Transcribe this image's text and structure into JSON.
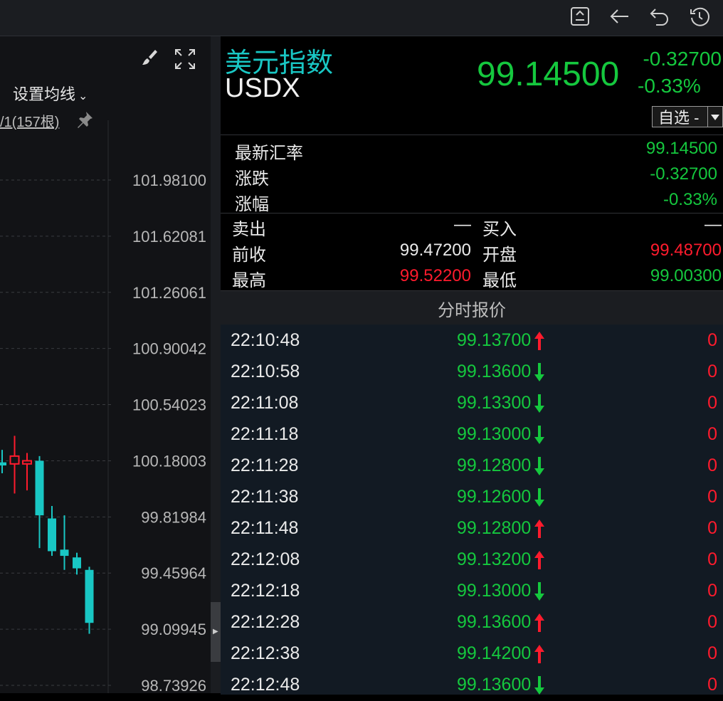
{
  "toolbar": {
    "icons": [
      "export-icon",
      "back-arrow-icon",
      "undo-icon",
      "history-icon"
    ]
  },
  "chart": {
    "ma_setting_label": "设置均线",
    "bars_info": "/1(157根)",
    "price_labels": [
      "101.98100",
      "101.62081",
      "101.26061",
      "100.90042",
      "100.54023",
      "100.18003",
      "99.81984",
      "99.45964",
      "99.09945",
      "98.73926"
    ]
  },
  "chart_data": {
    "type": "candlestick",
    "y_ticks": [
      101.981,
      101.62081,
      101.26061,
      100.90042,
      100.54023,
      100.18003,
      99.81984,
      99.45964,
      99.09945,
      98.73926
    ],
    "ylim": [
      98.73926,
      101.981
    ],
    "colors": {
      "up": "#ff1b2d",
      "down": "#19c7c4"
    },
    "candles": [
      {
        "open": 100.17,
        "close": 100.15,
        "high": 100.25,
        "low": 100.1
      },
      {
        "open": 100.16,
        "close": 100.21,
        "high": 100.34,
        "low": 99.97
      },
      {
        "open": 100.16,
        "close": 100.18,
        "high": 100.23,
        "low": 99.99
      },
      {
        "open": 100.18,
        "close": 99.83,
        "high": 100.21,
        "low": 99.62
      },
      {
        "open": 99.81,
        "close": 99.6,
        "high": 99.89,
        "low": 99.57
      },
      {
        "open": 99.61,
        "close": 99.57,
        "high": 99.83,
        "low": 99.48
      },
      {
        "open": 99.56,
        "close": 99.49,
        "high": 99.59,
        "low": 99.45
      },
      {
        "open": 99.48,
        "close": 99.14,
        "high": 99.5,
        "low": 99.07
      }
    ]
  },
  "quote": {
    "name_cn": "美元指数",
    "name_en": "USDX",
    "price": "99.14500",
    "change": "-0.32700",
    "change_pct": "-0.33%",
    "watchlist_label": "自选 -"
  },
  "stats": [
    {
      "label": "最新汇率",
      "value": "99.14500",
      "color": "green"
    },
    {
      "label": "涨跌",
      "value": "-0.32700",
      "color": "green"
    },
    {
      "label": "涨幅",
      "value": "-0.33%",
      "color": "green"
    }
  ],
  "stats2": [
    {
      "k1": "卖出",
      "v1": "—",
      "c1": "white",
      "k2": "买入",
      "v2": "—",
      "c2": "white"
    },
    {
      "k1": "前收",
      "v1": "99.47200",
      "c1": "white",
      "k2": "开盘",
      "v2": "99.48700",
      "c2": "red"
    },
    {
      "k1": "最高",
      "v1": "99.52200",
      "c1": "red",
      "k2": "最低",
      "v2": "99.00300",
      "c2": "green"
    }
  ],
  "ticks_header": "分时报价",
  "ticks": [
    {
      "time": "22:10:48",
      "price": "99.13700",
      "dir": "up",
      "qty": "0"
    },
    {
      "time": "22:10:58",
      "price": "99.13600",
      "dir": "down",
      "qty": "0"
    },
    {
      "time": "22:11:08",
      "price": "99.13300",
      "dir": "down",
      "qty": "0"
    },
    {
      "time": "22:11:18",
      "price": "99.13000",
      "dir": "down",
      "qty": "0"
    },
    {
      "time": "22:11:28",
      "price": "99.12800",
      "dir": "down",
      "qty": "0"
    },
    {
      "time": "22:11:38",
      "price": "99.12600",
      "dir": "down",
      "qty": "0"
    },
    {
      "time": "22:11:48",
      "price": "99.12800",
      "dir": "up",
      "qty": "0"
    },
    {
      "time": "22:12:08",
      "price": "99.13200",
      "dir": "up",
      "qty": "0"
    },
    {
      "time": "22:12:18",
      "price": "99.13000",
      "dir": "down",
      "qty": "0"
    },
    {
      "time": "22:12:28",
      "price": "99.13600",
      "dir": "up",
      "qty": "0"
    },
    {
      "time": "22:12:38",
      "price": "99.14200",
      "dir": "up",
      "qty": "0"
    },
    {
      "time": "22:12:48",
      "price": "99.13600",
      "dir": "down",
      "qty": "0"
    }
  ]
}
